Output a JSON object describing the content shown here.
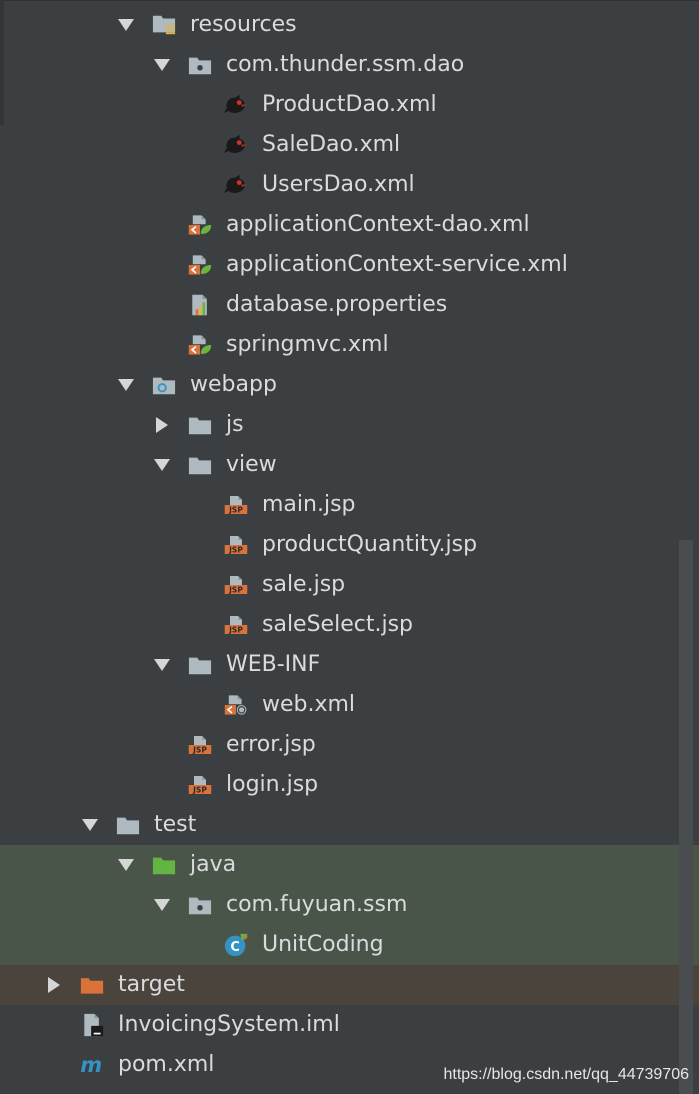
{
  "tree": [
    {
      "label": "resources",
      "arrow": "down",
      "icon": "resources-folder-icon",
      "depth": 3
    },
    {
      "label": "com.thunder.ssm.dao",
      "arrow": "down",
      "icon": "package-folder-icon",
      "depth": 4
    },
    {
      "label": "ProductDao.xml",
      "arrow": "none",
      "icon": "mybatis-bird-icon",
      "depth": 5
    },
    {
      "label": "SaleDao.xml",
      "arrow": "none",
      "icon": "mybatis-bird-icon",
      "depth": 5
    },
    {
      "label": "UsersDao.xml",
      "arrow": "none",
      "icon": "mybatis-bird-icon",
      "depth": 5
    },
    {
      "label": "applicationContext-dao.xml",
      "arrow": "none",
      "icon": "spring-xml-icon",
      "depth": 4
    },
    {
      "label": "applicationContext-service.xml",
      "arrow": "none",
      "icon": "spring-xml-icon",
      "depth": 4
    },
    {
      "label": "database.properties",
      "arrow": "none",
      "icon": "properties-file-icon",
      "depth": 4
    },
    {
      "label": "springmvc.xml",
      "arrow": "none",
      "icon": "spring-xml-icon",
      "depth": 4
    },
    {
      "label": "webapp",
      "arrow": "down",
      "icon": "web-folder-icon",
      "depth": 3
    },
    {
      "label": "js",
      "arrow": "right",
      "icon": "folder-icon",
      "depth": 4
    },
    {
      "label": "view",
      "arrow": "down",
      "icon": "folder-icon",
      "depth": 4
    },
    {
      "label": "main.jsp",
      "arrow": "none",
      "icon": "jsp-file-icon",
      "depth": 5
    },
    {
      "label": "productQuantity.jsp",
      "arrow": "none",
      "icon": "jsp-file-icon",
      "depth": 5
    },
    {
      "label": "sale.jsp",
      "arrow": "none",
      "icon": "jsp-file-icon",
      "depth": 5
    },
    {
      "label": "saleSelect.jsp",
      "arrow": "none",
      "icon": "jsp-file-icon",
      "depth": 5
    },
    {
      "label": "WEB-INF",
      "arrow": "down",
      "icon": "folder-icon",
      "depth": 4
    },
    {
      "label": "web.xml",
      "arrow": "none",
      "icon": "web-xml-icon",
      "depth": 5
    },
    {
      "label": "error.jsp",
      "arrow": "none",
      "icon": "jsp-file-icon",
      "depth": 4
    },
    {
      "label": "login.jsp",
      "arrow": "none",
      "icon": "jsp-file-icon",
      "depth": 4
    },
    {
      "label": "test",
      "arrow": "down",
      "icon": "folder-icon",
      "depth": 2
    },
    {
      "label": "java",
      "arrow": "down",
      "icon": "test-source-folder-icon",
      "depth": 3,
      "highlight": "test"
    },
    {
      "label": "com.fuyuan.ssm",
      "arrow": "down",
      "icon": "package-folder-icon",
      "depth": 4,
      "highlight": "test"
    },
    {
      "label": "UnitCoding",
      "arrow": "none",
      "icon": "java-class-icon",
      "depth": 5,
      "highlight": "test"
    },
    {
      "label": "target",
      "arrow": "right",
      "icon": "excluded-folder-icon",
      "depth": 1,
      "highlight": "target"
    },
    {
      "label": "InvoicingSystem.iml",
      "arrow": "none",
      "icon": "iml-file-icon",
      "depth": 1
    },
    {
      "label": "pom.xml",
      "arrow": "none",
      "icon": "maven-pom-icon",
      "depth": 1
    }
  ],
  "watermark": "https://blog.csdn.net/qq_44739706",
  "colors": {
    "background": "#3c3f41",
    "test_highlight": "#4a5549",
    "target_highlight": "#4a443d",
    "folder": "#aeb9c0",
    "test_folder": "#62b543",
    "excluded_folder": "#d9733b",
    "jsp": "#d9733b",
    "spring_leaf": "#6db33f"
  }
}
